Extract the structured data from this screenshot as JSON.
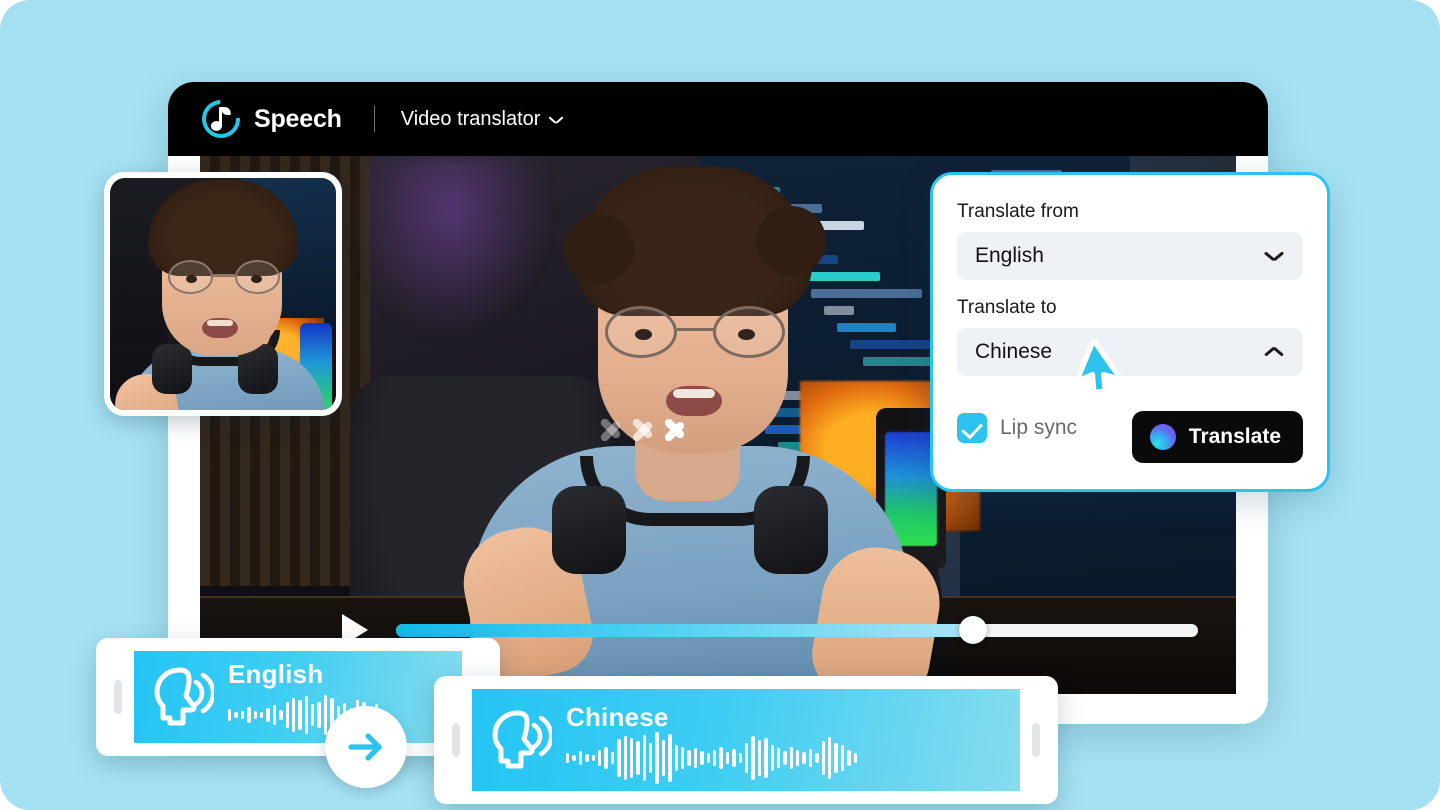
{
  "theme": {
    "page_bg": "#a4e2f3",
    "accent_cyan": "#2ec2ef",
    "header_bg": "#000000",
    "panel_border": "#2ec2ef",
    "select_bg": "#eef2f6",
    "button_bg": "#0a0a0a"
  },
  "header": {
    "brand": "Speech",
    "logo_icon": "speech-logo-icon",
    "menu_label": "Video translator",
    "menu_chevron_icon": "chevron-down-icon"
  },
  "player": {
    "play_icon": "play-icon",
    "progress_percent": 72,
    "transition_icon": "chevron-right-icon"
  },
  "thumbnail": {
    "name": "source-video-thumbnail"
  },
  "panel": {
    "from_label": "Translate from",
    "from_value": "English",
    "from_chevron_icon": "chevron-down-icon",
    "to_label": "Translate to",
    "to_value": "Chinese",
    "to_chevron_icon": "chevron-up-icon",
    "lip_sync_label": "Lip sync",
    "lip_sync_checked": true,
    "translate_button_label": "Translate",
    "translate_button_icon": "ai-orb-icon"
  },
  "cursor": {
    "icon": "mouse-pointer-icon",
    "color": "#2ec2ef"
  },
  "audio_cards": [
    {
      "language": "English",
      "icon": "speaking-head-icon",
      "waveform": [
        12,
        6,
        8,
        16,
        8,
        6,
        14,
        20,
        10,
        26,
        34,
        30,
        38,
        22,
        26,
        40,
        34,
        18,
        24,
        14,
        30,
        26,
        16,
        22,
        10
      ]
    },
    {
      "language": "Chinese",
      "icon": "speaking-head-icon",
      "waveform": [
        10,
        6,
        14,
        8,
        6,
        16,
        22,
        12,
        38,
        44,
        40,
        34,
        46,
        30,
        52,
        36,
        48,
        26,
        22,
        16,
        20,
        14,
        10,
        16,
        22,
        12,
        18,
        10,
        30,
        44,
        36,
        40,
        26,
        20,
        14,
        22,
        16,
        12,
        18,
        10,
        34,
        42,
        30,
        26,
        16,
        10
      ]
    }
  ],
  "swap_button": {
    "icon": "arrow-right-icon",
    "name": "swap-languages-button"
  }
}
